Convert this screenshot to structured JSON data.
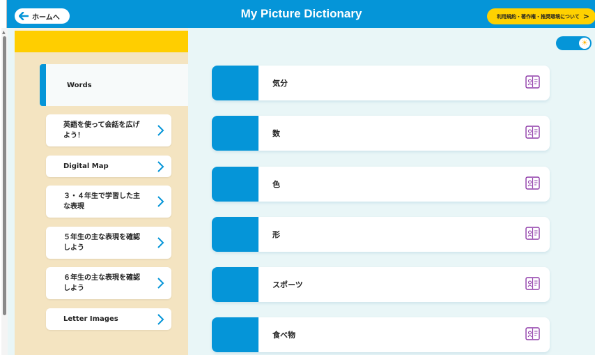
{
  "header": {
    "home_label": "ホームへ",
    "title": "My Picture Dictionary",
    "terms_label": "利用規約・著作権・推奨環境について",
    "terms_chevron": ">"
  },
  "sidebar": {
    "active_tab": "Words",
    "items": [
      {
        "label_line1": "英語を使って会話を広げ",
        "label_line2": "よう！"
      },
      {
        "label_line1": "Digital Map",
        "label_line2": ""
      },
      {
        "label_line1": "３・４年生で学習した主",
        "label_line2": "な表現"
      },
      {
        "label_line1": "５年生の主な表現を確認",
        "label_line2": "しよう"
      },
      {
        "label_line1": "６年生の主な表現を確認",
        "label_line2": "しよう"
      },
      {
        "label_line1": "Letter Images",
        "label_line2": ""
      }
    ]
  },
  "toggle": {
    "icon": "sun-icon",
    "state": "on"
  },
  "words": [
    {
      "label": "気分"
    },
    {
      "label": "数"
    },
    {
      "label": "色"
    },
    {
      "label": "形"
    },
    {
      "label": "スポーツ"
    },
    {
      "label": "食べ物"
    }
  ],
  "colors": {
    "primary_blue": "#0595d8",
    "accent_yellow": "#ffd100",
    "book_icon_purple": "#8e3aa8"
  }
}
